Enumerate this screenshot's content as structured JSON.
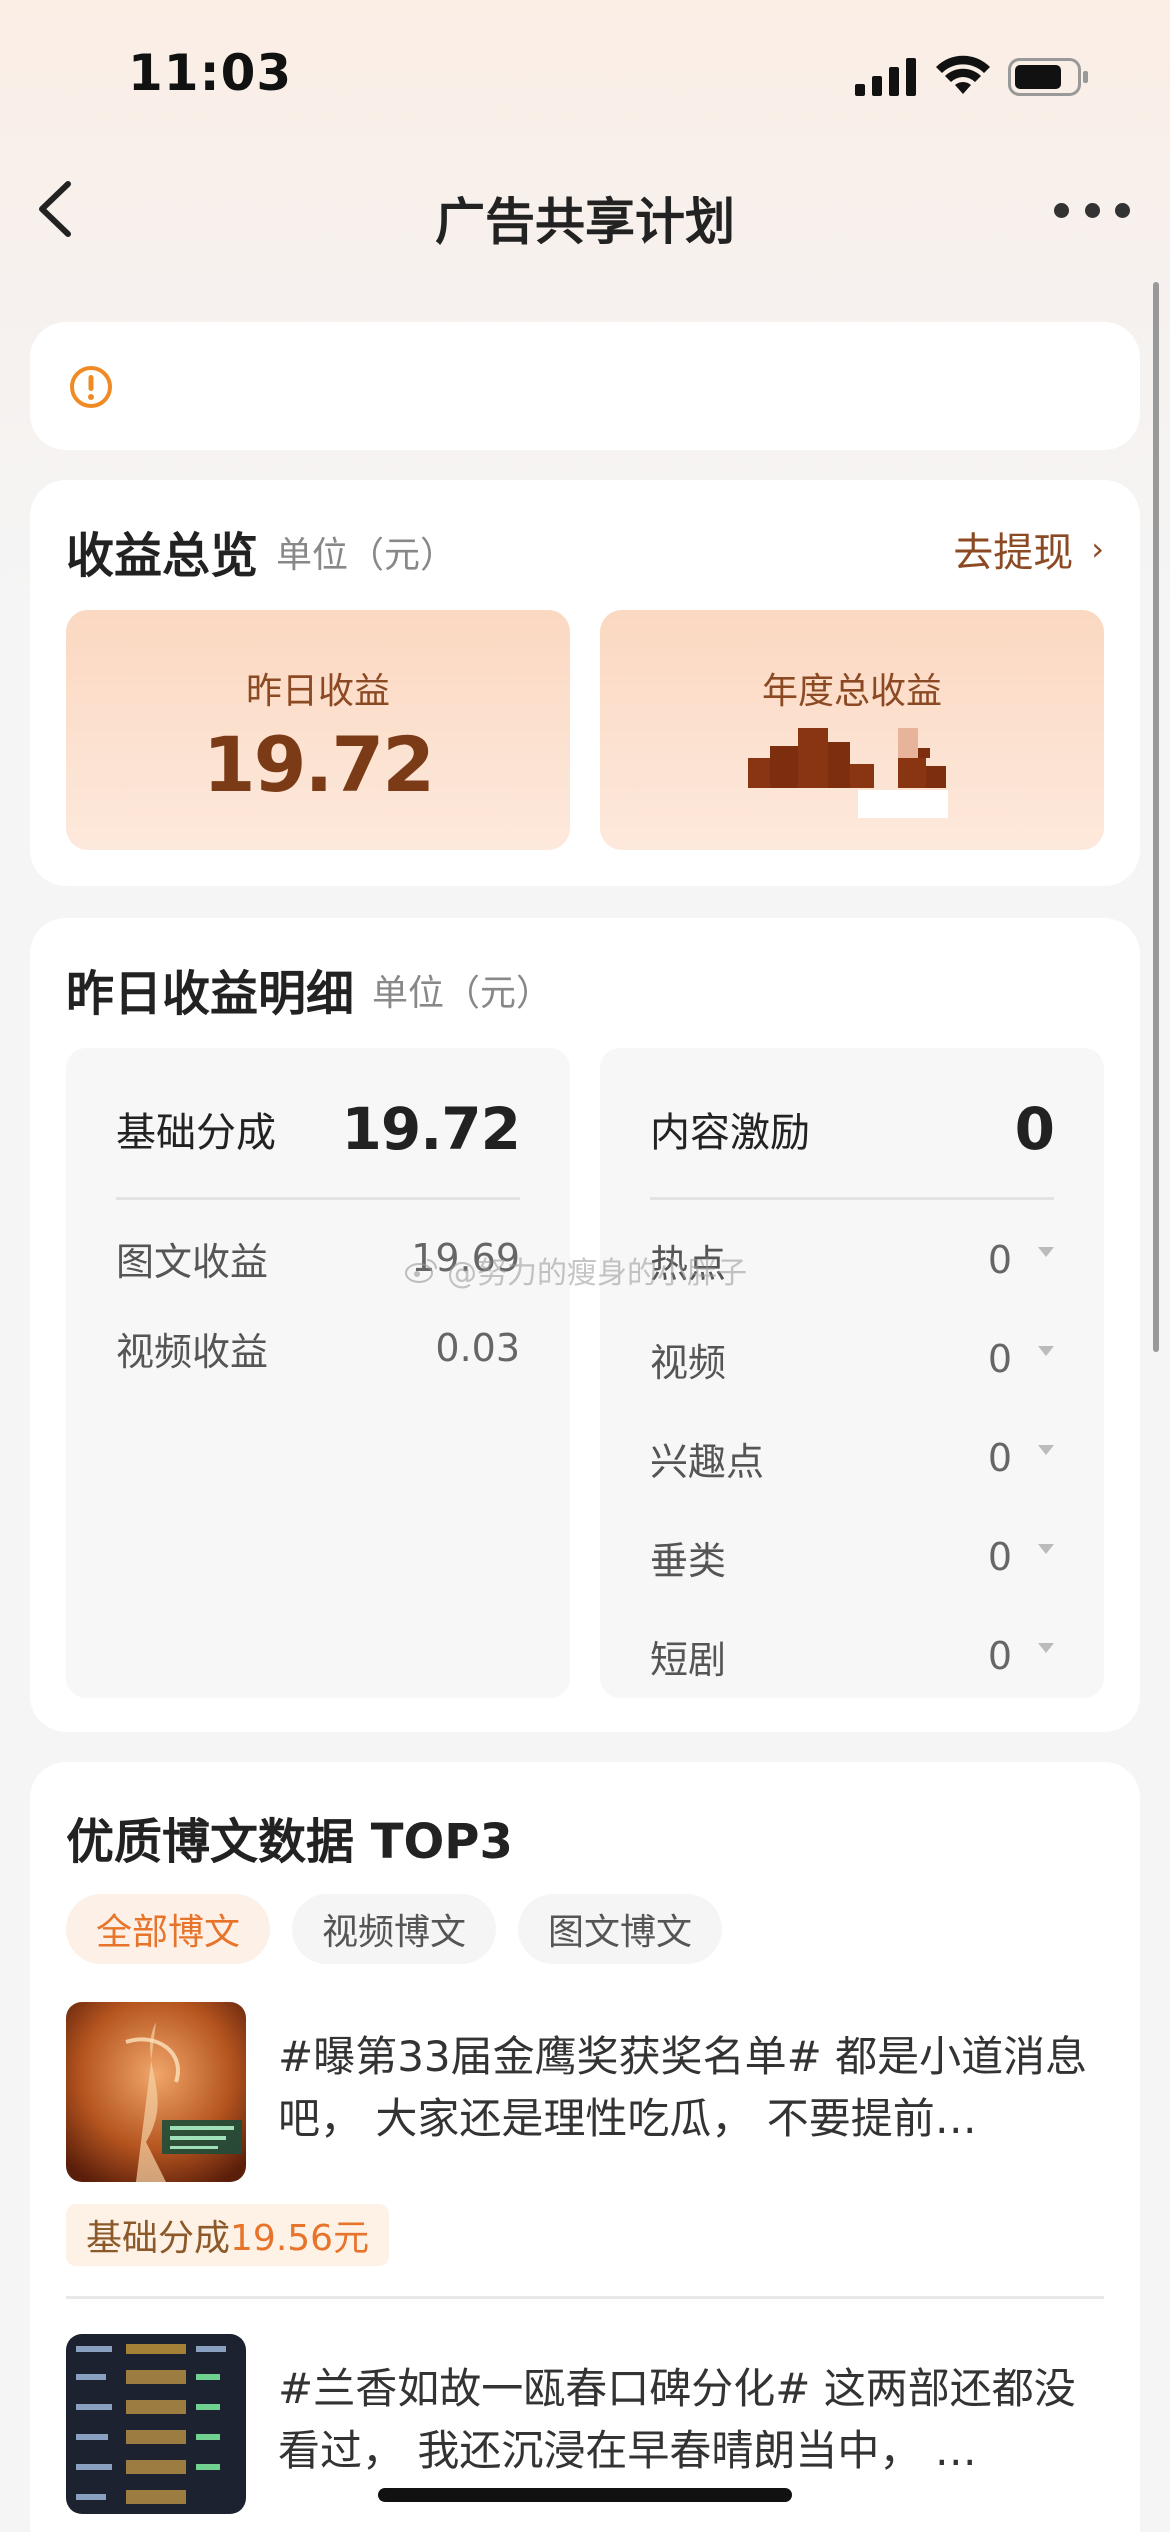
{
  "status_bar": {
    "time": "11:03"
  },
  "nav": {
    "title": "广告共享计划"
  },
  "overview": {
    "title": "收益总览",
    "unit": "单位（元）",
    "withdraw_label": "去提现",
    "yesterday": {
      "label": "昨日收益",
      "value": "19.72"
    },
    "annual": {
      "label": "年度总收益"
    }
  },
  "detail": {
    "title": "昨日收益明细",
    "unit": "单位（元）",
    "base": {
      "name": "基础分成",
      "total": "19.72",
      "rows": [
        {
          "label": "图文收益",
          "value": "19.69"
        },
        {
          "label": "视频收益",
          "value": "0.03"
        }
      ]
    },
    "incentive": {
      "name": "内容激励",
      "total": "0",
      "rows": [
        {
          "label": "热点",
          "value": "0"
        },
        {
          "label": "视频",
          "value": "0"
        },
        {
          "label": "兴趣点",
          "value": "0"
        },
        {
          "label": "垂类",
          "value": "0"
        },
        {
          "label": "短剧",
          "value": "0"
        }
      ]
    }
  },
  "watermark": "@努力的瘦身的小胖子",
  "top3": {
    "title": "优质博文数据 TOP3",
    "tabs": [
      "全部博文",
      "视频博文",
      "图文博文"
    ],
    "posts": [
      {
        "text": "#曝第33届金鹰奖获奖名单# 都是小道消息吧， 大家还是理性吃瓜， 不要提前…",
        "badge_label": "基础分成",
        "badge_amount": "19.56元"
      },
      {
        "text": "#兰香如故一瓯春口碑分化# 这两部还都没看过， 我还沉浸在早春晴朗当中， …"
      }
    ]
  },
  "colors": {
    "accent": "#e8732b",
    "brown": "#8c4a24",
    "earn_bg": "#fbd8c1"
  }
}
